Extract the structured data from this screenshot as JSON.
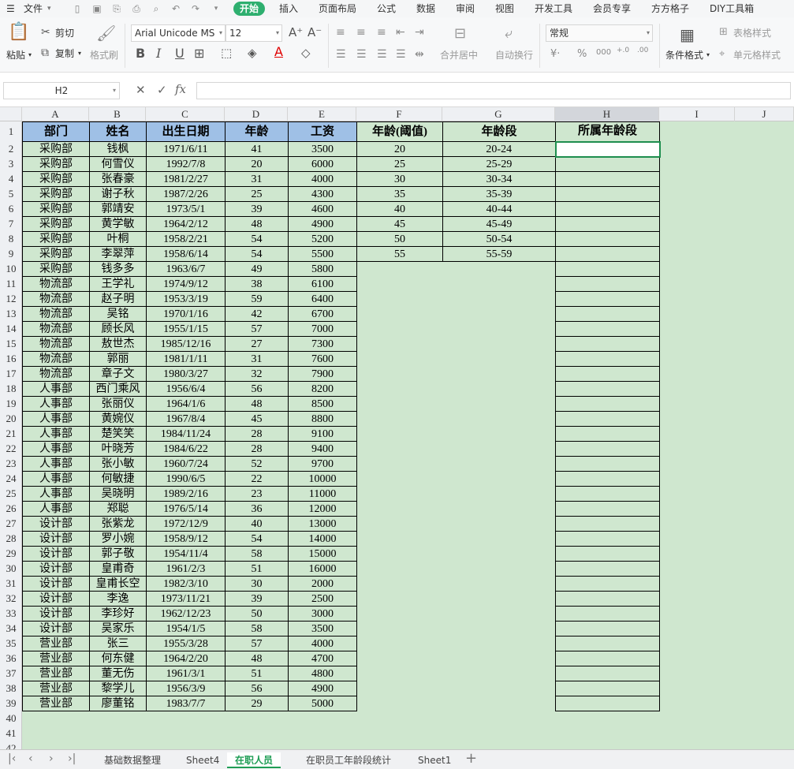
{
  "menu": {
    "file": "文件",
    "tabs": [
      "开始",
      "插入",
      "页面布局",
      "公式",
      "数据",
      "审阅",
      "视图",
      "开发工具",
      "会员专享",
      "方方格子",
      "DIY工具箱"
    ],
    "active_tab": "开始"
  },
  "ribbon": {
    "paste": "粘贴",
    "cut": "剪切",
    "copy": "复制",
    "format_painter": "格式刷",
    "font_name": "Arial Unicode MS",
    "font_size": "12",
    "merge_center": "合并居中",
    "wrap_text": "自动换行",
    "number_format": "常规",
    "conditional_format": "条件格式",
    "table_style": "表格样式",
    "cell_style": "单元格样式",
    "accent_color": "#2eaf6f",
    "font_color": "#e00000"
  },
  "formula_bar": {
    "name_box": "H2",
    "formula": ""
  },
  "columns": [
    "A",
    "B",
    "C",
    "D",
    "E",
    "F",
    "G",
    "H",
    "I",
    "J"
  ],
  "selected_column": "H",
  "headers": {
    "dept": "部门",
    "name": "姓名",
    "birth": "出生日期",
    "age": "年龄",
    "salary": "工资",
    "age_threshold": "年龄(阈值)",
    "age_band": "年龄段",
    "belongs_band": "所属年龄段"
  },
  "employees": [
    [
      "采购部",
      "钱枫",
      "1971/6/11",
      "41",
      "3500"
    ],
    [
      "采购部",
      "何雪仪",
      "1992/7/8",
      "20",
      "6000"
    ],
    [
      "采购部",
      "张春豪",
      "1981/2/27",
      "31",
      "4000"
    ],
    [
      "采购部",
      "谢子秋",
      "1987/2/26",
      "25",
      "4300"
    ],
    [
      "采购部",
      "郭靖安",
      "1973/5/1",
      "39",
      "4600"
    ],
    [
      "采购部",
      "黄学敏",
      "1964/2/12",
      "48",
      "4900"
    ],
    [
      "采购部",
      "叶桐",
      "1958/2/21",
      "54",
      "5200"
    ],
    [
      "采购部",
      "李翠萍",
      "1958/6/14",
      "54",
      "5500"
    ],
    [
      "采购部",
      "钱多多",
      "1963/6/7",
      "49",
      "5800"
    ],
    [
      "物流部",
      "王学礼",
      "1974/9/12",
      "38",
      "6100"
    ],
    [
      "物流部",
      "赵子明",
      "1953/3/19",
      "59",
      "6400"
    ],
    [
      "物流部",
      "吴铭",
      "1970/1/16",
      "42",
      "6700"
    ],
    [
      "物流部",
      "顾长风",
      "1955/1/15",
      "57",
      "7000"
    ],
    [
      "物流部",
      "敖世杰",
      "1985/12/16",
      "27",
      "7300"
    ],
    [
      "物流部",
      "郭丽",
      "1981/1/11",
      "31",
      "7600"
    ],
    [
      "物流部",
      "章子文",
      "1980/3/27",
      "32",
      "7900"
    ],
    [
      "人事部",
      "西门乘风",
      "1956/6/4",
      "56",
      "8200"
    ],
    [
      "人事部",
      "张丽仪",
      "1964/1/6",
      "48",
      "8500"
    ],
    [
      "人事部",
      "黄婉仪",
      "1967/8/4",
      "45",
      "8800"
    ],
    [
      "人事部",
      "楚笑笑",
      "1984/11/24",
      "28",
      "9100"
    ],
    [
      "人事部",
      "叶晓芳",
      "1984/6/22",
      "28",
      "9400"
    ],
    [
      "人事部",
      "张小敏",
      "1960/7/24",
      "52",
      "9700"
    ],
    [
      "人事部",
      "何敏捷",
      "1990/6/5",
      "22",
      "10000"
    ],
    [
      "人事部",
      "吴晓明",
      "1989/2/16",
      "23",
      "11000"
    ],
    [
      "人事部",
      "郑聪",
      "1976/5/14",
      "36",
      "12000"
    ],
    [
      "设计部",
      "张紫龙",
      "1972/12/9",
      "40",
      "13000"
    ],
    [
      "设计部",
      "罗小婉",
      "1958/9/12",
      "54",
      "14000"
    ],
    [
      "设计部",
      "郭子敬",
      "1954/11/4",
      "58",
      "15000"
    ],
    [
      "设计部",
      "皇甫奇",
      "1961/2/3",
      "51",
      "16000"
    ],
    [
      "设计部",
      "皇甫长空",
      "1982/3/10",
      "30",
      "2000"
    ],
    [
      "设计部",
      "李逸",
      "1973/11/21",
      "39",
      "2500"
    ],
    [
      "设计部",
      "李珍好",
      "1962/12/23",
      "50",
      "3000"
    ],
    [
      "设计部",
      "吴家乐",
      "1954/1/5",
      "58",
      "3500"
    ],
    [
      "营业部",
      "张三",
      "1955/3/28",
      "57",
      "4000"
    ],
    [
      "营业部",
      "何东健",
      "1964/2/20",
      "48",
      "4700"
    ],
    [
      "营业部",
      "董无伤",
      "1961/3/1",
      "51",
      "4800"
    ],
    [
      "营业部",
      "黎学儿",
      "1956/3/9",
      "56",
      "4900"
    ],
    [
      "营业部",
      "廖董铭",
      "1983/7/7",
      "29",
      "5000"
    ]
  ],
  "age_lookup": [
    [
      "20",
      "20-24"
    ],
    [
      "25",
      "25-29"
    ],
    [
      "30",
      "30-34"
    ],
    [
      "35",
      "35-39"
    ],
    [
      "40",
      "40-44"
    ],
    [
      "45",
      "45-49"
    ],
    [
      "50",
      "50-54"
    ],
    [
      "55",
      "55-59"
    ]
  ],
  "sheet_tabs": [
    "基础数据整理",
    "Sheet4",
    "在职人员",
    "在职员工年龄段统计",
    "Sheet1"
  ],
  "active_sheet": "在职人员",
  "colors": {
    "sheet_bg": "#cfe7cf",
    "header_blue": "#9fc0e6",
    "header_red": "#e00000",
    "selection_green": "#1e8e4e"
  }
}
